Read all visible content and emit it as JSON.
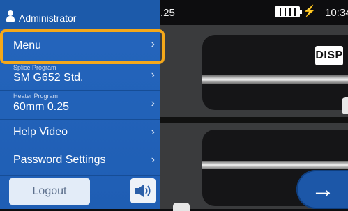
{
  "status": {
    "left_text": ".25",
    "time": "10:34"
  },
  "display": {
    "disp_label": "DISP",
    "next_arrow": "→"
  },
  "sidebar": {
    "user_role": "Administrator",
    "menu_label": "Menu",
    "splice_program_caption": "Splice Program",
    "splice_program_value": "SM G652 Std.",
    "heater_program_caption": "Heater Program",
    "heater_program_value": "60mm 0.25",
    "help_video_label": "Help Video",
    "password_settings_label": "Password Settings",
    "chevron": "›",
    "logout_label": "Logout"
  },
  "icons": [
    "user-icon",
    "battery-icon",
    "charging-icon",
    "speaker-icon",
    "chevron-right-icon",
    "arrow-right-icon"
  ],
  "colors": {
    "sidebar": "#2566bd",
    "highlight": "#f5a81a",
    "next_button": "#1c57a8"
  }
}
